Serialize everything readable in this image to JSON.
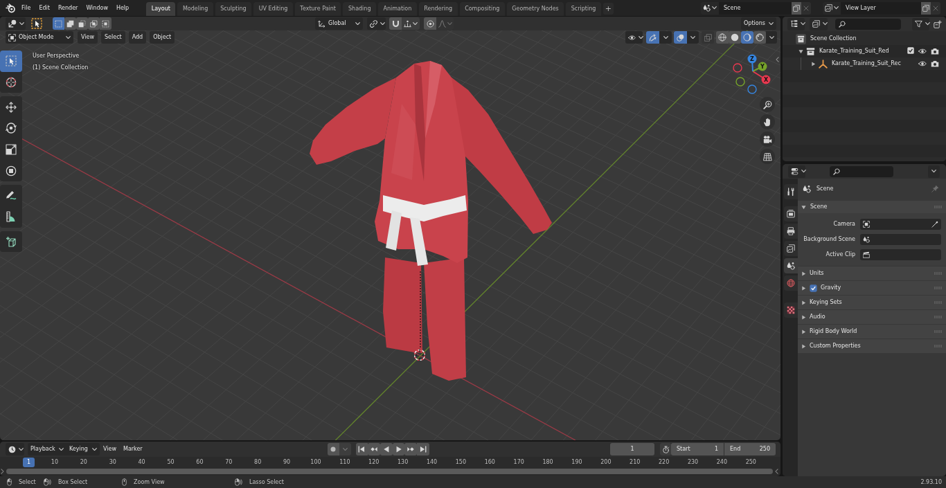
{
  "top_bar": {
    "menus": [
      "File",
      "Edit",
      "Render",
      "Window",
      "Help"
    ],
    "workspaces": [
      {
        "label": "Layout",
        "selected": true
      },
      {
        "label": "Modeling",
        "selected": false
      },
      {
        "label": "Sculpting",
        "selected": false
      },
      {
        "label": "UV Editing",
        "selected": false
      },
      {
        "label": "Texture Paint",
        "selected": false
      },
      {
        "label": "Shading",
        "selected": false
      },
      {
        "label": "Animation",
        "selected": false
      },
      {
        "label": "Rendering",
        "selected": false
      },
      {
        "label": "Compositing",
        "selected": false
      },
      {
        "label": "Geometry Nodes",
        "selected": false
      },
      {
        "label": "Scripting",
        "selected": false
      }
    ],
    "add_workspace": "+",
    "scene": "Scene",
    "view_layer": "View Layer"
  },
  "viewport": {
    "tool_header": {
      "select_modes": [
        {
          "selected": true
        },
        {
          "selected": false
        },
        {
          "selected": false
        },
        {
          "selected": false
        },
        {
          "selected": false
        }
      ],
      "orientation": "Global",
      "snap_on": false,
      "proportional_on": false,
      "options": "Options"
    },
    "header": {
      "mode": "Object Mode",
      "menus": [
        "View",
        "Select",
        "Add",
        "Object"
      ],
      "gizmos_on": true,
      "overlays_on": true,
      "xray_on": false,
      "shading_modes": [
        {
          "selected": false
        },
        {
          "selected": false
        },
        {
          "selected": true
        },
        {
          "selected": false
        }
      ]
    },
    "tool_groups": [
      {
        "tools": [
          {
            "selected": true
          },
          {
            "selected": false
          }
        ]
      },
      {
        "tools": [
          {
            "selected": false
          },
          {
            "selected": false
          },
          {
            "selected": false
          },
          {
            "selected": false
          }
        ]
      },
      {
        "tools": [
          {
            "selected": false
          },
          {
            "selected": false
          }
        ]
      },
      {
        "tools": [
          {
            "selected": false
          }
        ]
      }
    ],
    "info": [
      "User Perspective",
      "(1) Scene Collection"
    ],
    "gizmo": {
      "axes": [
        {
          "label": "X",
          "color": "#e8384f"
        },
        {
          "label": "Y",
          "color": "#76a32a"
        },
        {
          "label": "Z",
          "color": "#3585e0"
        }
      ]
    }
  },
  "outliner": {
    "tree": [
      {
        "kind": "scene_collection",
        "label": "Scene Collection",
        "children": [
          {
            "kind": "collection",
            "label": "Karate_Training_Suit_Red",
            "expanded": true,
            "checked": true,
            "children": [
              {
                "kind": "object",
                "label": "Karate_Training_Suit_Rec",
                "expanded": false
              }
            ]
          }
        ]
      }
    ]
  },
  "properties": {
    "tab_groups": [
      {
        "tabs": [
          {
            "selected": false
          }
        ]
      },
      {
        "tabs": [
          {
            "selected": false
          },
          {
            "selected": false
          },
          {
            "selected": false
          },
          {
            "selected": true
          },
          {
            "selected": false
          }
        ]
      },
      {
        "tabs": [
          {
            "selected": false
          }
        ]
      }
    ],
    "context": "Scene",
    "pinned": false,
    "panel": {
      "label": "Scene",
      "expanded": true,
      "fields": [
        {
          "kind": "object",
          "label": "Camera"
        },
        {
          "kind": "scene",
          "label": "Background Scene"
        },
        {
          "kind": "clip",
          "label": "Active Clip"
        }
      ]
    },
    "subpanels": [
      {
        "kind": "plain",
        "label": "Units",
        "expanded": false
      },
      {
        "kind": "checkbox",
        "label": "Gravity",
        "checked": true,
        "expanded": false
      },
      {
        "kind": "plain",
        "label": "Keying Sets",
        "expanded": false
      },
      {
        "kind": "plain",
        "label": "Audio",
        "expanded": false
      },
      {
        "kind": "plain",
        "label": "Rigid Body World",
        "expanded": false
      },
      {
        "kind": "plain",
        "label": "Custom Properties",
        "expanded": false
      }
    ]
  },
  "timeline": {
    "menus": [
      {
        "kind": "dropdown",
        "label": "Playback"
      },
      {
        "kind": "dropdown",
        "label": "Keying"
      },
      {
        "kind": "menu",
        "label": "View"
      },
      {
        "kind": "menu",
        "label": "Marker"
      }
    ],
    "auto_keying_on": false,
    "current_frame": "1",
    "preview_range_on": false,
    "start_label": "Start",
    "start": "1",
    "end_label": "End",
    "end": "250",
    "ruler": {
      "current": "1",
      "ticks": [
        "10",
        "20",
        "30",
        "40",
        "50",
        "60",
        "70",
        "80",
        "90",
        "100",
        "110",
        "120",
        "130",
        "140",
        "150",
        "160",
        "170",
        "180",
        "190",
        "200",
        "210",
        "220",
        "230",
        "240",
        "250"
      ]
    }
  },
  "status_bar": {
    "hints": [
      {
        "kind": "left_click",
        "label": "Select"
      },
      {
        "kind": "left_drag",
        "label": "Box Select"
      },
      {
        "kind": "middle_click",
        "label": "Zoom View"
      },
      {
        "kind": "right_drag",
        "label": "Lasso Select"
      }
    ],
    "version": "2.93.10"
  }
}
